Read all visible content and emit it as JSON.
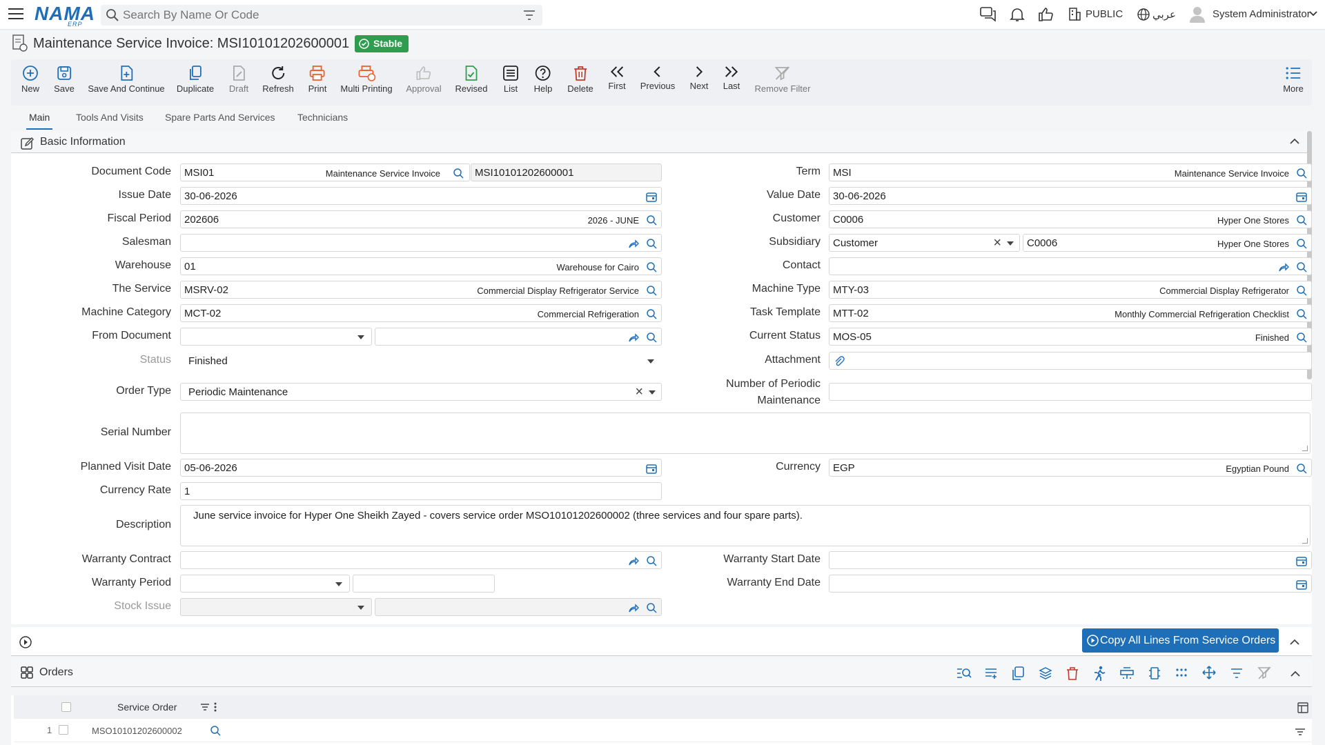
{
  "app": {
    "logo": "NAMA",
    "logo_sub": "ERP"
  },
  "topbar": {
    "search_placeholder": "Search By Name Or Code",
    "visibility": "PUBLIC",
    "language": "عربي",
    "user": "System Administrator"
  },
  "page": {
    "title": "Maintenance Service Invoice: MSI10101202600001",
    "status": "Stable"
  },
  "toolbar": {
    "new": "New",
    "save": "Save",
    "save_continue": "Save And Continue",
    "duplicate": "Duplicate",
    "draft": "Draft",
    "refresh": "Refresh",
    "print": "Print",
    "multi_printing": "Multi Printing",
    "approval": "Approval",
    "revised": "Revised",
    "list": "List",
    "help": "Help",
    "delete": "Delete",
    "first": "First",
    "previous": "Previous",
    "next": "Next",
    "last": "Last",
    "remove_filter": "Remove Filter",
    "more": "More"
  },
  "tabs": [
    "Main",
    "Tools And Visits",
    "Spare Parts And Services",
    "Technicians"
  ],
  "basic_section": {
    "title": "Basic Information"
  },
  "form": {
    "document_code": {
      "label": "Document Code",
      "code": "MSI01",
      "desc": "Maintenance Service Invoice",
      "number": "MSI10101202600001"
    },
    "issue_date": {
      "label": "Issue Date",
      "value": "30-06-2026"
    },
    "fiscal_period": {
      "label": "Fiscal Period",
      "value": "202606",
      "desc": "2026 - JUNE"
    },
    "salesman": {
      "label": "Salesman",
      "value": ""
    },
    "warehouse": {
      "label": "Warehouse",
      "value": "01",
      "desc": "Warehouse for Cairo"
    },
    "service": {
      "label": "The Service",
      "value": "MSRV-02",
      "desc": "Commercial Display Refrigerator Service"
    },
    "machine_category": {
      "label": "Machine Category",
      "value": "MCT-02",
      "desc": "Commercial Refrigeration"
    },
    "from_document": {
      "label": "From Document"
    },
    "status": {
      "label": "Status",
      "value": "Finished"
    },
    "order_type": {
      "label": "Order Type",
      "value": "Periodic Maintenance"
    },
    "serial_number": {
      "label": "Serial Number",
      "value": ""
    },
    "planned_visit_date": {
      "label": "Planned Visit Date",
      "value": "05-06-2026"
    },
    "currency_rate": {
      "label": "Currency Rate",
      "value": "1"
    },
    "description": {
      "label": "Description",
      "value": "June service invoice for Hyper One Sheikh Zayed - covers service order MSO10101202600002 (three services and four spare parts)."
    },
    "warranty_contract": {
      "label": "Warranty Contract"
    },
    "warranty_period": {
      "label": "Warranty Period"
    },
    "stock_issue": {
      "label": "Stock Issue"
    },
    "term": {
      "label": "Term",
      "value": "MSI",
      "desc": "Maintenance Service Invoice"
    },
    "value_date": {
      "label": "Value Date",
      "value": "30-06-2026"
    },
    "customer": {
      "label": "Customer",
      "value": "C0006",
      "desc": "Hyper One Stores"
    },
    "subsidiary": {
      "label": "Subsidiary",
      "type": "Customer",
      "value": "C0006",
      "desc": "Hyper One Stores"
    },
    "contact": {
      "label": "Contact"
    },
    "machine_type": {
      "label": "Machine Type",
      "value": "MTY-03",
      "desc": "Commercial Display Refrigerator"
    },
    "task_template": {
      "label": "Task Template",
      "value": "MTT-02",
      "desc": "Monthly Commercial Refrigeration Checklist"
    },
    "current_status": {
      "label": "Current Status",
      "value": "MOS-05",
      "desc": "Finished"
    },
    "attachment": {
      "label": "Attachment"
    },
    "periodic_count": {
      "label_1": "Number of Periodic",
      "label_2": "Maintenance",
      "value": ""
    },
    "currency": {
      "label": "Currency",
      "value": "EGP",
      "desc": "Egyptian Pound"
    },
    "warranty_start": {
      "label": "Warranty Start Date"
    },
    "warranty_end": {
      "label": "Warranty End Date"
    }
  },
  "copy_button": "Copy All Lines From Service Orders",
  "orders": {
    "title": "Orders",
    "column": "Service Order",
    "rows": [
      {
        "index": "1",
        "service_order": "MSO10101202600002"
      }
    ]
  },
  "colors": {
    "accent": "#1e6fb8",
    "status_green": "#2e9d4f",
    "print_orange": "#e8622c",
    "delete_red": "#c0392b",
    "revised_green": "#2e9d4f"
  }
}
